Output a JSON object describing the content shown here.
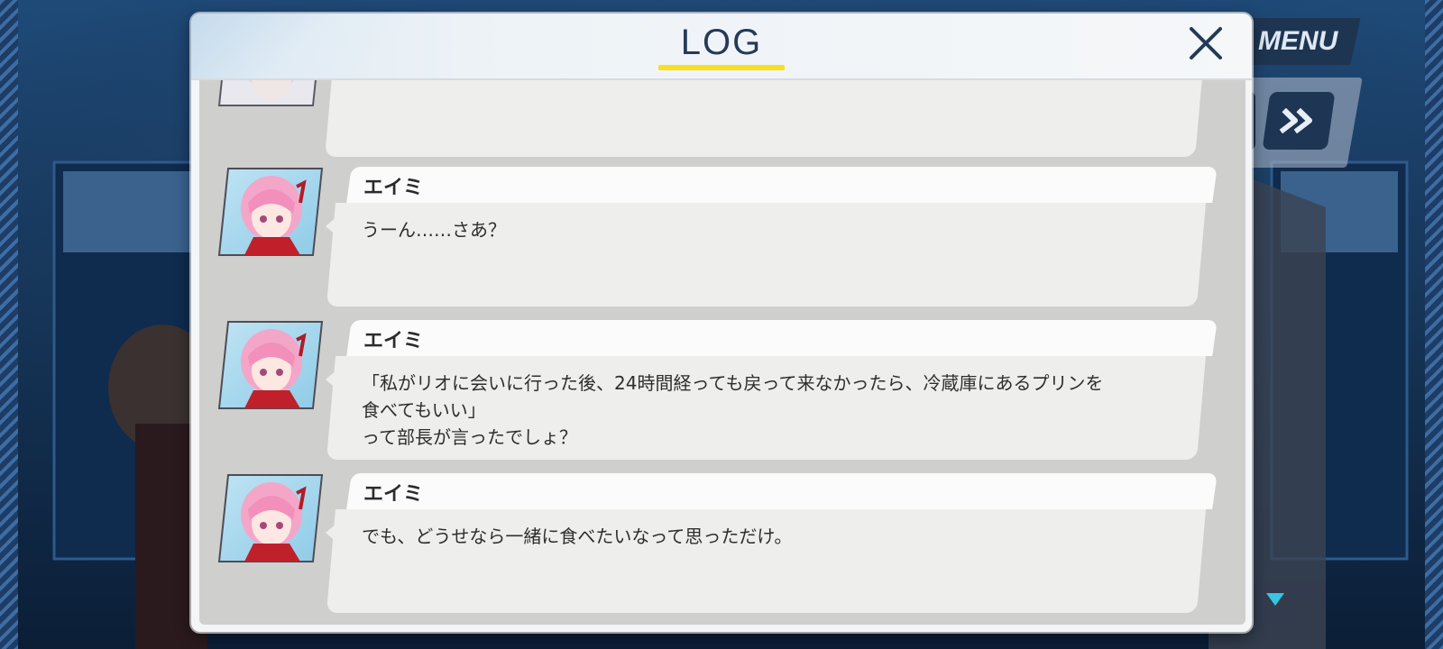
{
  "header": {
    "title": "LOG",
    "accent_color": "#f7e01f"
  },
  "hud": {
    "menu_label": "MENU"
  },
  "log_entries": [
    {
      "speaker": "",
      "text": "",
      "partial": true
    },
    {
      "speaker": "エイミ",
      "text": "うーん……さあ？"
    },
    {
      "speaker": "エイミ",
      "text": "「私がリオに会いに行った後、24時間経っても戻って来なかったら、冷蔵庫にあるプリンを\n食べてもいい」\nって部長が言ったでしょ？"
    },
    {
      "speaker": "エイミ",
      "text": "でも、どうせなら一緒に食べたいなって思っただけ。"
    }
  ],
  "colors": {
    "title_text": "#243a58",
    "scroll_indicator": "#37c7e6"
  }
}
